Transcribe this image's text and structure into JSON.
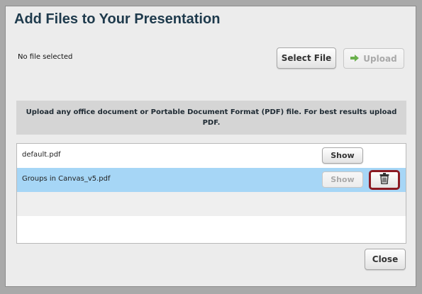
{
  "dialog": {
    "title": "Add Files to Your Presentation",
    "status": "No file selected",
    "select_file_label": "Select File",
    "upload_label": "Upload",
    "notice": "Upload any office document or Portable Document Format (PDF) file.  For best results upload PDF.",
    "close_label": "Close"
  },
  "files": [
    {
      "name": "default.pdf",
      "show_label": "Show",
      "selected": false
    },
    {
      "name": "Groups in Canvas_v5.pdf",
      "show_label": "Show",
      "selected": true
    }
  ],
  "colors": {
    "selected_row": "#a6d6f6",
    "delete_highlight": "#8b1a22",
    "title": "#1e3a4c"
  },
  "icons": {
    "upload": "upload-arrow-icon",
    "delete": "trash-icon"
  }
}
